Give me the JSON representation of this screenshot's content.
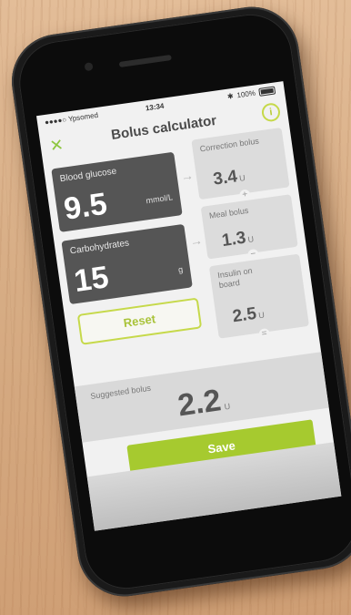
{
  "status_bar": {
    "carrier": "●●●●○ Ypsomed",
    "time": "13:34",
    "battery": "100%"
  },
  "header": {
    "title": "Bolus calculator",
    "close_icon": "close-icon",
    "info_label": "i"
  },
  "inputs": {
    "blood_glucose": {
      "label": "Blood glucose",
      "value": "9.5",
      "unit": "mmol/L"
    },
    "carbohydrates": {
      "label": "Carbohydrates",
      "value": "15",
      "unit": "g"
    }
  },
  "reset_label": "Reset",
  "results": {
    "correction": {
      "label": "Correction bolus",
      "value": "3.4",
      "unit": "U"
    },
    "meal": {
      "label": "Meal bolus",
      "value": "1.3",
      "unit": "U"
    },
    "iob": {
      "label": "Insulin on board",
      "value": "2.5",
      "unit": "U"
    }
  },
  "operators": {
    "plus": "+",
    "minus": "−",
    "equals": "="
  },
  "suggested": {
    "label": "Suggested bolus",
    "value": "2.2",
    "unit": "U"
  },
  "save_label": "Save",
  "colors": {
    "accent": "#a6ca2f",
    "dark_box": "#555555",
    "light_box": "#dcdcdc"
  }
}
